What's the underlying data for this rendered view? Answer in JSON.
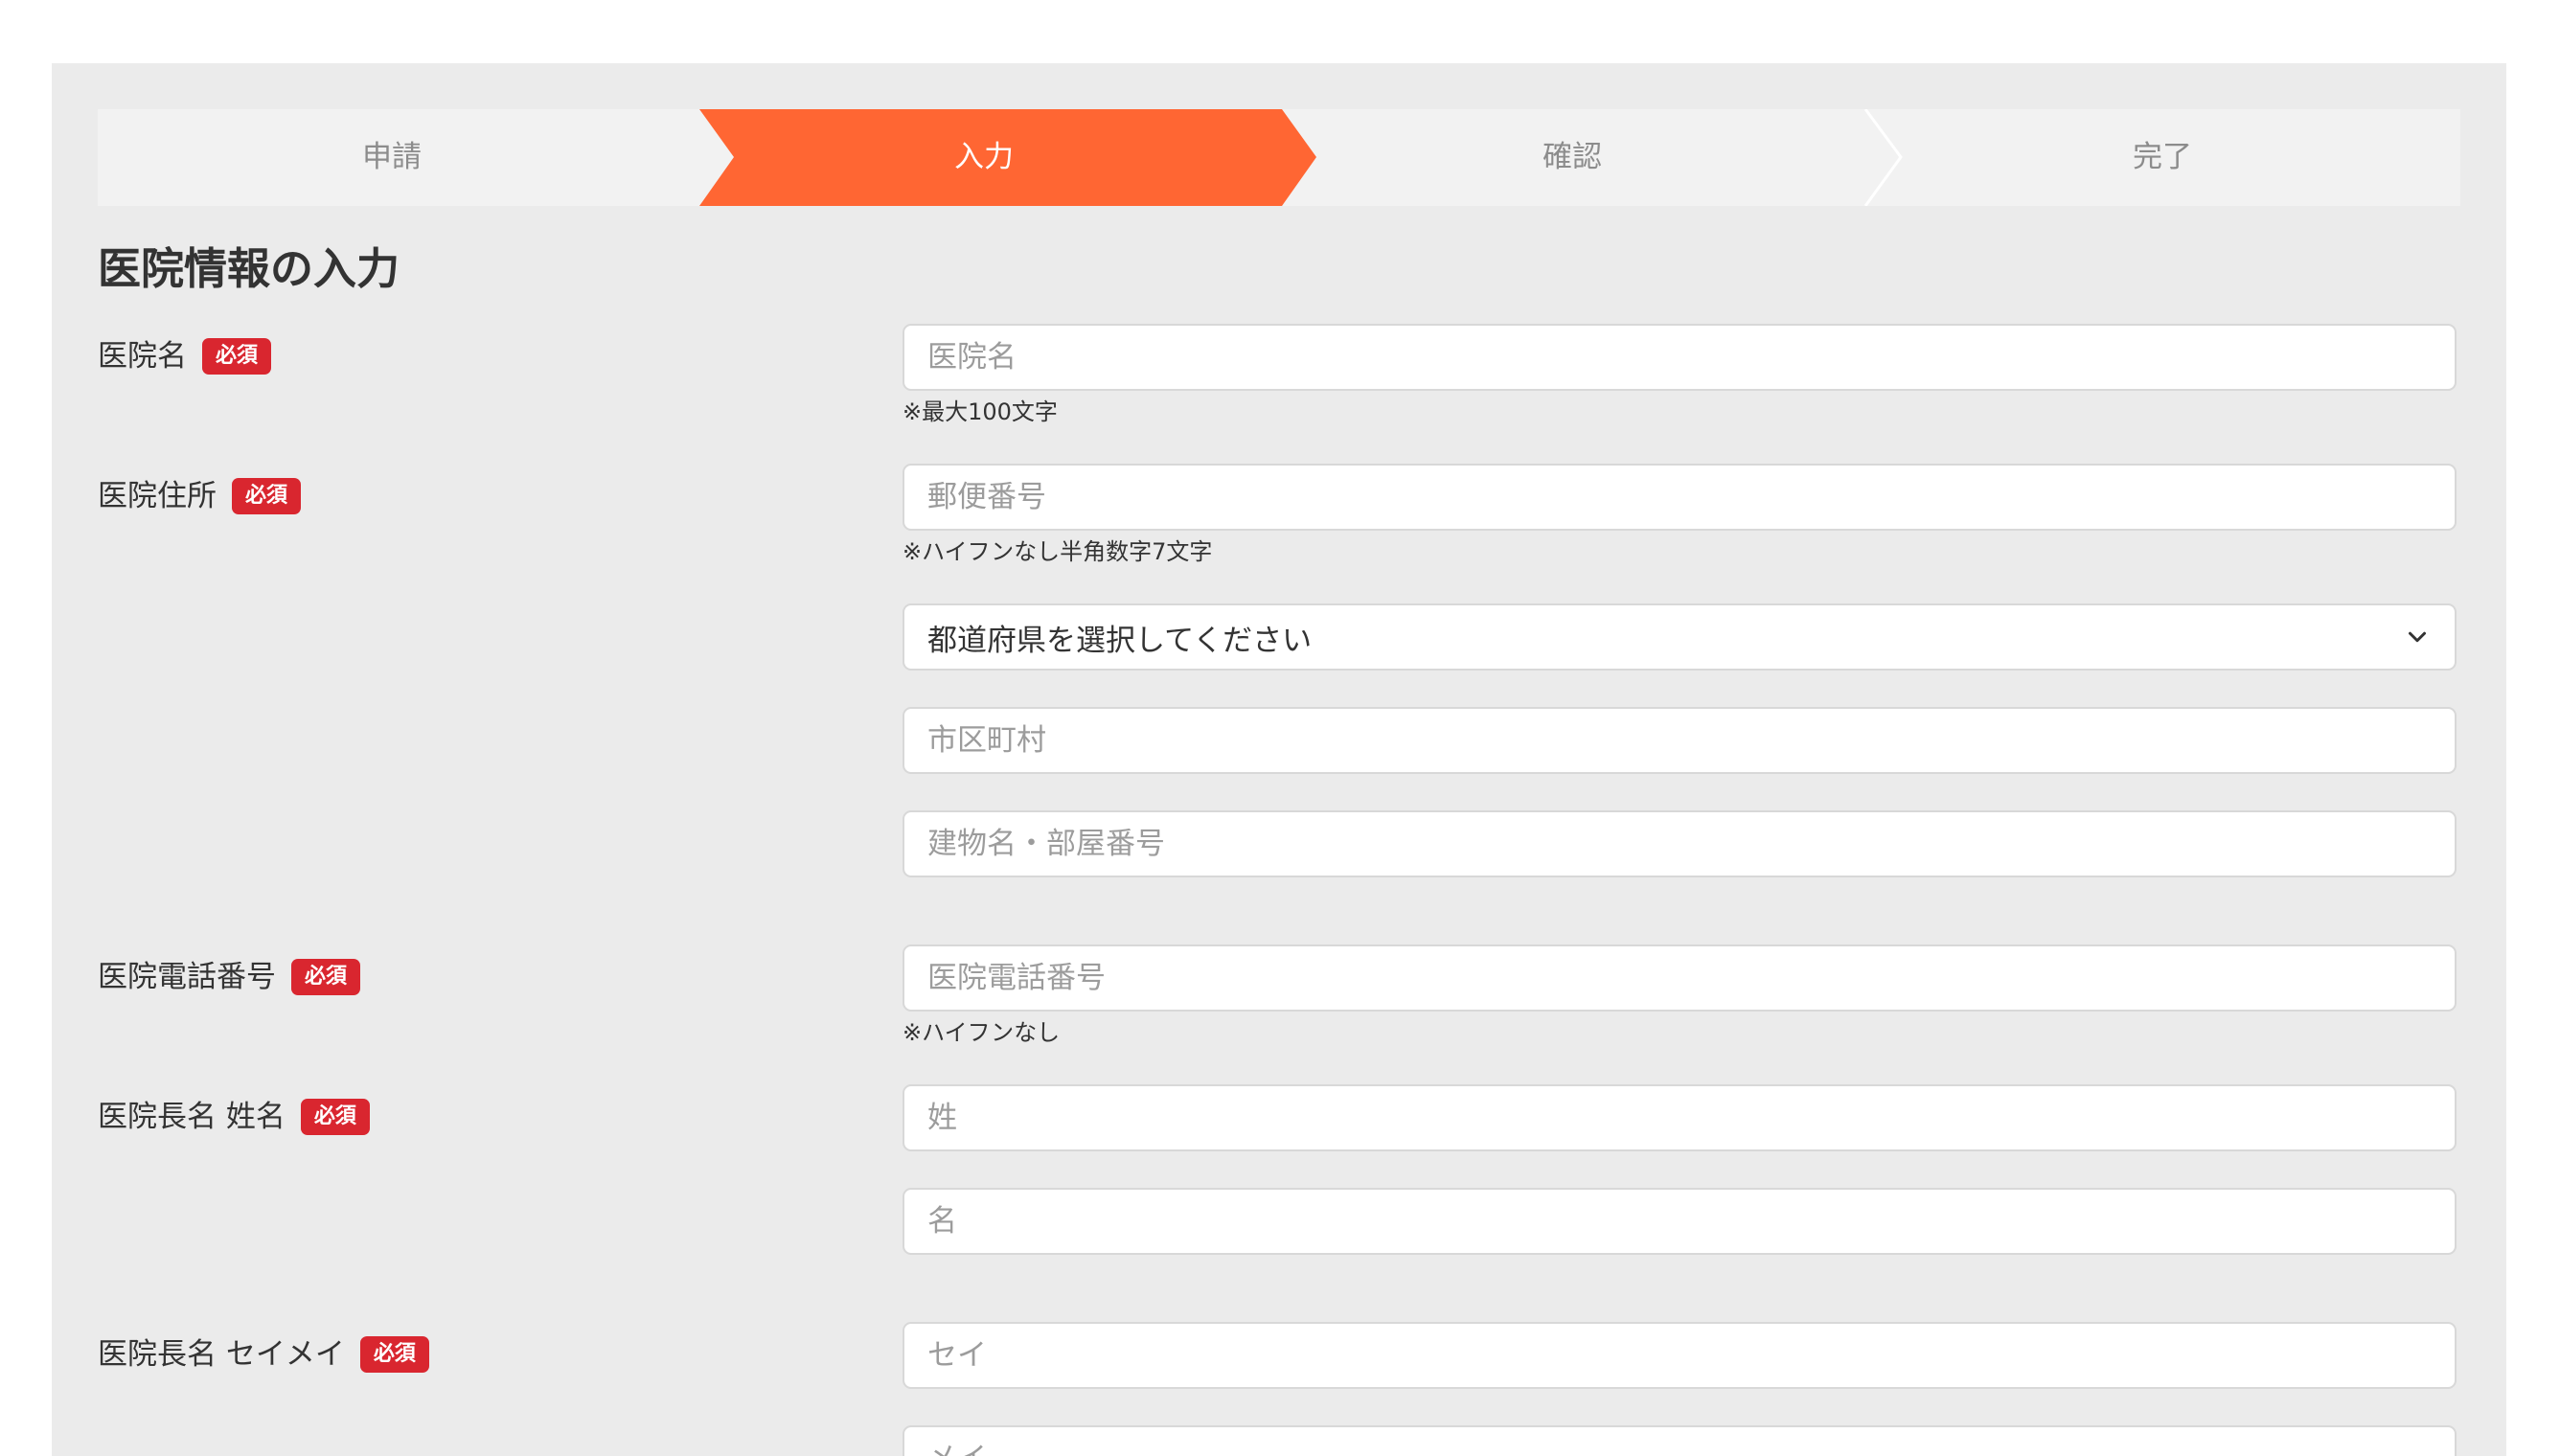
{
  "stepper": {
    "steps": [
      {
        "label": "申請",
        "active": false
      },
      {
        "label": "入力",
        "active": true
      },
      {
        "label": "確認",
        "active": false
      },
      {
        "label": "完了",
        "active": false
      }
    ],
    "active_color": "#ff6633",
    "inactive_color": "#f2f2f2"
  },
  "page_title": "医院情報の入力",
  "required_badge": "必須",
  "clinic_name": {
    "label": "医院名",
    "placeholder": "医院名",
    "hint": "※最大100文字"
  },
  "clinic_address": {
    "label": "医院住所",
    "postal_placeholder": "郵便番号",
    "postal_hint": "※ハイフンなし半角数字7文字",
    "prefecture_value": "都道府県を選択してください",
    "prefecture_icon": "chevron-down-icon",
    "city_placeholder": "市区町村",
    "building_placeholder": "建物名・部屋番号"
  },
  "clinic_phone": {
    "label": "医院電話番号",
    "placeholder": "医院電話番号",
    "hint": "※ハイフンなし"
  },
  "director_name": {
    "label": "医院長名 姓名",
    "last_placeholder": "姓",
    "first_placeholder": "名"
  },
  "director_kana": {
    "label": "医院長名 セイメイ",
    "last_placeholder": "セイ",
    "first_placeholder": "メイ"
  },
  "badge_color": "#d9262f"
}
